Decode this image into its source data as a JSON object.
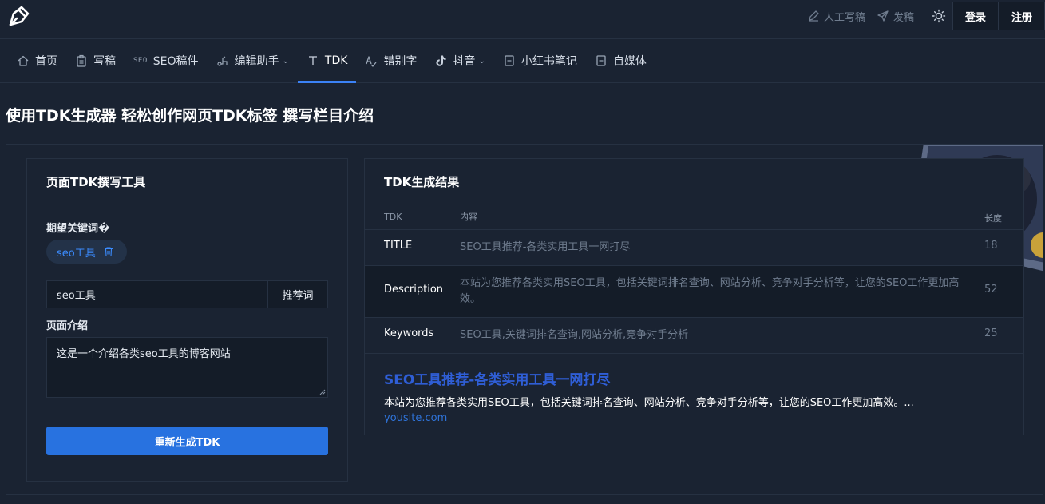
{
  "topbar": {
    "manual_write": "人工写稿",
    "publish": "发稿",
    "login": "登录",
    "register": "注册"
  },
  "nav": {
    "items": [
      {
        "label": "首页",
        "icon": "home-icon"
      },
      {
        "label": "写稿",
        "icon": "clipboard-icon"
      },
      {
        "label": "SEO稿件",
        "icon": "seo-icon",
        "badge": "SEO"
      },
      {
        "label": "编辑助手",
        "icon": "edit-assistant-icon",
        "dropdown": true
      },
      {
        "label": "TDK",
        "icon": "text-t-icon",
        "active": true
      },
      {
        "label": "错别字",
        "icon": "spellcheck-icon"
      },
      {
        "label": "抖音",
        "icon": "tiktok-icon",
        "dropdown": true
      },
      {
        "label": "小红书笔记",
        "icon": "note-icon"
      },
      {
        "label": "自媒体",
        "icon": "media-icon"
      }
    ]
  },
  "page_title": "使用TDK生成器 轻松创作网页TDK标签 撰写栏目介绍",
  "left_panel": {
    "title": "页面TDK撰写工具",
    "keyword_label": "期望关键词�",
    "tag": "seo工具",
    "keyword_value": "seo工具",
    "recommend_button": "推荐词",
    "intro_label": "页面介绍",
    "intro_value": "这是一个介绍各类seo工具的博客网站",
    "regenerate_button": "重新生成TDK"
  },
  "right_panel": {
    "title": "TDK生成结果",
    "headers": {
      "tdk": "TDK",
      "content": "内容",
      "length": "长度"
    },
    "rows": [
      {
        "tdk": "TITLE",
        "content": "SEO工具推荐-各类实用工具一网打尽",
        "length": "18"
      },
      {
        "tdk": "Description",
        "content": "本站为您推荐各类实用SEO工具，包括关键词排名查询、网站分析、竞争对手分析等，让您的SEO工作更加高效。",
        "length": "52"
      },
      {
        "tdk": "Keywords",
        "content": "SEO工具,关键词排名查询,网站分析,竞争对手分析",
        "length": "25"
      }
    ],
    "preview": {
      "title": "SEO工具推荐-各类实用工具一网打尽",
      "description": "本站为您推荐各类实用SEO工具，包括关键词排名查询、网站分析、竞争对手分析等，让您的SEO工作更加高效。...",
      "url": "yousite.com"
    }
  },
  "colors": {
    "background": "#1a2332",
    "accent": "#2872e0",
    "link": "#3b8cff",
    "preview_title": "#2f5ed6"
  }
}
